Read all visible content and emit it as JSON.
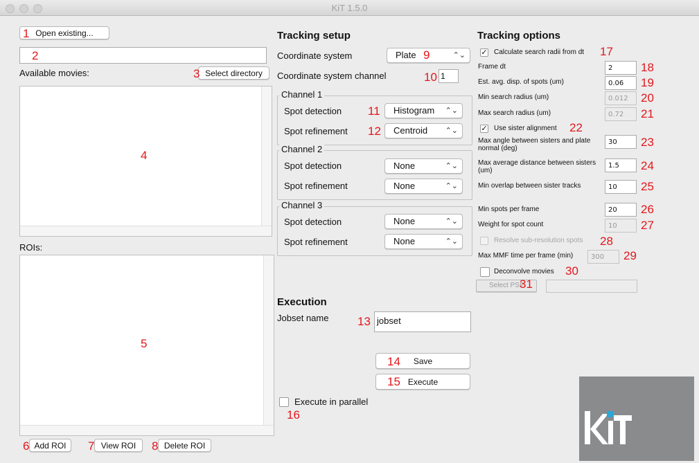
{
  "window": {
    "title": "KiT 1.5.0"
  },
  "left": {
    "open_existing": "Open existing...",
    "path_value": "",
    "available_movies": "Available movies:",
    "select_directory": "Select directory",
    "rois_label": "ROIs:",
    "add_roi": "Add ROI",
    "view_roi": "View ROI",
    "delete_roi": "Delete ROI"
  },
  "setup": {
    "header": "Tracking setup",
    "coord_system_label": "Coordinate system",
    "coord_system_value": "Plate",
    "coord_channel_label": "Coordinate system channel",
    "coord_channel_value": "1",
    "channels": [
      {
        "title": "Channel 1",
        "detect_label": "Spot detection",
        "detect_value": "Histogram",
        "refine_label": "Spot refinement",
        "refine_value": "Centroid"
      },
      {
        "title": "Channel 2",
        "detect_label": "Spot detection",
        "detect_value": "None",
        "refine_label": "Spot refinement",
        "refine_value": "None"
      },
      {
        "title": "Channel 3",
        "detect_label": "Spot detection",
        "detect_value": "None",
        "refine_label": "Spot refinement",
        "refine_value": "None"
      }
    ]
  },
  "execution": {
    "header": "Execution",
    "jobset_label": "Jobset name",
    "jobset_value": "jobset",
    "save": "Save",
    "execute": "Execute",
    "parallel": "Execute in parallel"
  },
  "options": {
    "header": "Tracking options",
    "calc_radii": "Calculate search radii from dt",
    "frame_dt_label": "Frame dt",
    "frame_dt": "2",
    "est_disp_label": "Est. avg. disp. of spots (um)",
    "est_disp": "0.06",
    "min_radius_label": "Min search radius (um)",
    "min_radius": "0.012",
    "max_radius_label": "Max search radius (um)",
    "max_radius": "0.72",
    "sister_align": "Use sister alignment",
    "max_angle_label": "Max angle between sisters and plate normal (deg)",
    "max_angle": "30",
    "max_dist_label": "Max average distance between sisters (um)",
    "max_dist": "1.5",
    "min_overlap_label": "Min overlap between sister tracks",
    "min_overlap": "10",
    "min_spots_label": "Min spots per frame",
    "min_spots": "20",
    "weight_label": "Weight for spot count",
    "weight": "10",
    "resolve_sub": "Resolve sub-resolution spots",
    "max_mmf_label": "Max MMF time per frame (min)",
    "max_mmf": "300",
    "deconvolve": "Deconvolve movies",
    "select_psf": "Select PSF",
    "psf_path": ""
  },
  "annotations": [
    "1",
    "2",
    "3",
    "4",
    "5",
    "6",
    "7",
    "8",
    "9",
    "10",
    "11",
    "12",
    "13",
    "14",
    "15",
    "16",
    "17",
    "18",
    "19",
    "20",
    "21",
    "22",
    "23",
    "24",
    "25",
    "26",
    "27",
    "28",
    "29",
    "30",
    "31"
  ],
  "logo": {
    "text": "kiT"
  },
  "colors": {
    "annotation": "#e3161b",
    "logo_bg": "#8a8b8d"
  }
}
